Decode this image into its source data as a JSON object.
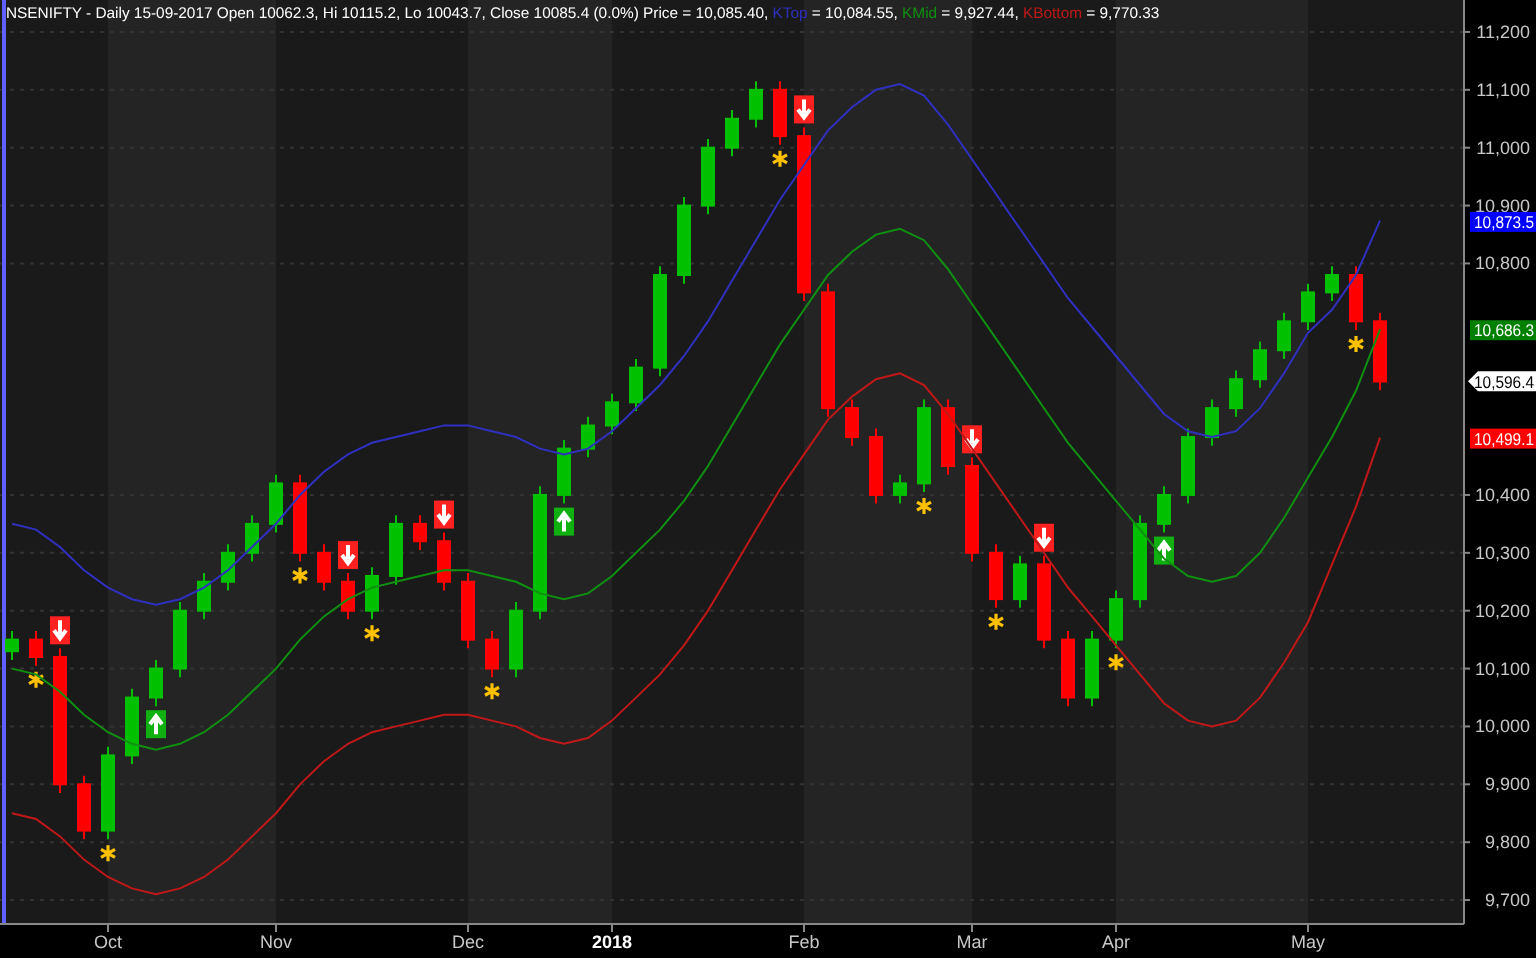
{
  "header": {
    "text": "NSENIFTY - Daily 15-09-2017 Open 10062.3, Hi 10115.2, Lo 10043.7, Close 10085.4 (0.0%) Price = 10,085.40, ",
    "values": [
      " = 10,084.55, ",
      " = 9,927.44, ",
      " = 9,770.33"
    ]
  },
  "chart": {
    "chart_data": {
      "type": "candlestick",
      "grid": true,
      "categories": [
        null,
        null,
        null,
        null,
        "Oct",
        null,
        null,
        null,
        null,
        null,
        null,
        "Nov",
        null,
        null,
        null,
        null,
        null,
        null,
        null,
        "Dec",
        null,
        null,
        null,
        null,
        null,
        "2018",
        null,
        null,
        null,
        null,
        null,
        null,
        null,
        "Feb",
        null,
        null,
        null,
        null,
        null,
        null,
        "Mar",
        null,
        null,
        null,
        null,
        null,
        "Apr",
        null,
        null,
        null,
        null,
        null,
        null,
        null,
        "May",
        null,
        null,
        null,
        null,
        null,
        null
      ],
      "ohlc": [
        [
          10130,
          10165,
          10115,
          10150
        ],
        [
          10150,
          10165,
          10105,
          10120
        ],
        [
          10120,
          10135,
          9885,
          9900
        ],
        [
          9900,
          9915,
          9805,
          9820
        ],
        [
          9820,
          9965,
          9805,
          9950
        ],
        [
          9950,
          10065,
          9935,
          10050
        ],
        [
          10050,
          10115,
          10035,
          10100
        ],
        [
          10100,
          10215,
          10085,
          10200
        ],
        [
          10200,
          10265,
          10185,
          10250
        ],
        [
          10250,
          10315,
          10235,
          10300
        ],
        [
          10300,
          10365,
          10285,
          10350
        ],
        [
          10350,
          10435,
          10335,
          10420
        ],
        [
          10420,
          10435,
          10285,
          10300
        ],
        [
          10300,
          10315,
          10235,
          10250
        ],
        [
          10250,
          10265,
          10185,
          10200
        ],
        [
          10200,
          10275,
          10185,
          10260
        ],
        [
          10260,
          10365,
          10245,
          10350
        ],
        [
          10350,
          10365,
          10305,
          10320
        ],
        [
          10320,
          10335,
          10235,
          10250
        ],
        [
          10250,
          10265,
          10135,
          10150
        ],
        [
          10150,
          10165,
          10085,
          10100
        ],
        [
          10100,
          10215,
          10085,
          10200
        ],
        [
          10200,
          10415,
          10185,
          10400
        ],
        [
          10400,
          10495,
          10385,
          10480
        ],
        [
          10480,
          10535,
          10465,
          10520
        ],
        [
          10520,
          10575,
          10505,
          10560
        ],
        [
          10560,
          10635,
          10545,
          10620
        ],
        [
          10620,
          10795,
          10605,
          10780
        ],
        [
          10780,
          10915,
          10765,
          10900
        ],
        [
          10900,
          11015,
          10885,
          11000
        ],
        [
          11000,
          11065,
          10985,
          11050
        ],
        [
          11050,
          11115,
          11035,
          11100
        ],
        [
          11100,
          11115,
          11005,
          11020
        ],
        [
          11020,
          11035,
          10735,
          10750
        ],
        [
          10750,
          10765,
          10535,
          10550
        ],
        [
          10550,
          10565,
          10485,
          10500
        ],
        [
          10500,
          10515,
          10385,
          10400
        ],
        [
          10400,
          10435,
          10385,
          10420
        ],
        [
          10420,
          10565,
          10405,
          10550
        ],
        [
          10550,
          10565,
          10435,
          10450
        ],
        [
          10450,
          10465,
          10285,
          10300
        ],
        [
          10300,
          10315,
          10205,
          10220
        ],
        [
          10220,
          10295,
          10205,
          10280
        ],
        [
          10280,
          10295,
          10135,
          10150
        ],
        [
          10150,
          10165,
          10035,
          10050
        ],
        [
          10050,
          10165,
          10035,
          10150
        ],
        [
          10150,
          10235,
          10135,
          10220
        ],
        [
          10220,
          10365,
          10205,
          10350
        ],
        [
          10350,
          10415,
          10335,
          10400
        ],
        [
          10400,
          10515,
          10385,
          10500
        ],
        [
          10500,
          10565,
          10485,
          10550
        ],
        [
          10550,
          10615,
          10535,
          10600
        ],
        [
          10600,
          10665,
          10585,
          10650
        ],
        [
          10650,
          10715,
          10635,
          10700
        ],
        [
          10700,
          10765,
          10685,
          10750
        ],
        [
          10750,
          10795,
          10735,
          10780
        ],
        [
          10780,
          10795,
          10685,
          10700
        ],
        [
          10700,
          10715,
          10581,
          10596
        ],
        null,
        null,
        null
      ],
      "series": [
        {
          "name": "KTop",
          "type": "line",
          "color": "#3030c0",
          "values": [
            10350,
            10340,
            10310,
            10270,
            10240,
            10220,
            10210,
            10220,
            10240,
            10270,
            10310,
            10350,
            10400,
            10440,
            10470,
            10490,
            10500,
            10510,
            10520,
            10520,
            10510,
            10500,
            10480,
            10470,
            10480,
            10510,
            10550,
            10590,
            10640,
            10700,
            10770,
            10840,
            10910,
            10970,
            11030,
            11070,
            11100,
            11110,
            11090,
            11040,
            10980,
            10920,
            10860,
            10800,
            10740,
            10690,
            10640,
            10590,
            10540,
            10510,
            10500,
            10510,
            10550,
            10610,
            10680,
            10720,
            10780,
            10874,
            null,
            null,
            null
          ]
        },
        {
          "name": "KMid",
          "type": "line",
          "color": "#109010",
          "values": [
            10100,
            10090,
            10060,
            10020,
            9990,
            9970,
            9960,
            9970,
            9990,
            10020,
            10060,
            10100,
            10150,
            10190,
            10220,
            10240,
            10250,
            10260,
            10270,
            10270,
            10260,
            10250,
            10230,
            10220,
            10230,
            10260,
            10300,
            10340,
            10390,
            10450,
            10520,
            10590,
            10660,
            10720,
            10780,
            10820,
            10850,
            10860,
            10840,
            10790,
            10730,
            10670,
            10610,
            10550,
            10490,
            10440,
            10390,
            10340,
            10290,
            10260,
            10250,
            10260,
            10300,
            10360,
            10430,
            10500,
            10580,
            10686,
            null,
            null,
            null
          ]
        },
        {
          "name": "KBottom",
          "type": "line",
          "color": "#c01818",
          "values": [
            9850,
            9840,
            9810,
            9770,
            9740,
            9720,
            9710,
            9720,
            9740,
            9770,
            9810,
            9850,
            9900,
            9940,
            9970,
            9990,
            10000,
            10010,
            10020,
            10020,
            10010,
            10000,
            9980,
            9970,
            9980,
            10010,
            10050,
            10090,
            10140,
            10200,
            10270,
            10340,
            10410,
            10470,
            10530,
            10570,
            10600,
            10610,
            10590,
            10540,
            10480,
            10420,
            10360,
            10300,
            10240,
            10190,
            10140,
            10090,
            10040,
            10010,
            10000,
            10010,
            10050,
            10110,
            10180,
            10280,
            10380,
            10499,
            null,
            null,
            null
          ]
        }
      ],
      "ylim": [
        9650,
        11250
      ],
      "yticks": [
        {
          "value": 9700,
          "label": "9,700"
        },
        {
          "value": 9800,
          "label": "9,800"
        },
        {
          "value": 9900,
          "label": "9,900"
        },
        {
          "value": 10000,
          "label": "10,000"
        },
        {
          "value": 10100,
          "label": "10,100"
        },
        {
          "value": 10200,
          "label": "10,200"
        },
        {
          "value": 10300,
          "label": "10,300"
        },
        {
          "value": 10400,
          "label": "10,400"
        },
        {
          "value": 10800,
          "label": "10,800"
        },
        {
          "value": 10900,
          "label": "10,900"
        },
        {
          "value": 11000,
          "label": "11,000"
        },
        {
          "value": 11100,
          "label": "11,100"
        },
        {
          "value": 11200,
          "label": "11,200"
        }
      ]
    },
    "value_flags": [
      {
        "kind": "band",
        "label": "10,873.5",
        "color": "#0000ff"
      },
      {
        "kind": "band",
        "label": "10,686.3",
        "color": "#008000"
      },
      {
        "kind": "price",
        "label": "10,596.4",
        "color": "#ffffff"
      },
      {
        "kind": "band",
        "label": "10,499.1",
        "color": "#ff0000"
      }
    ]
  }
}
